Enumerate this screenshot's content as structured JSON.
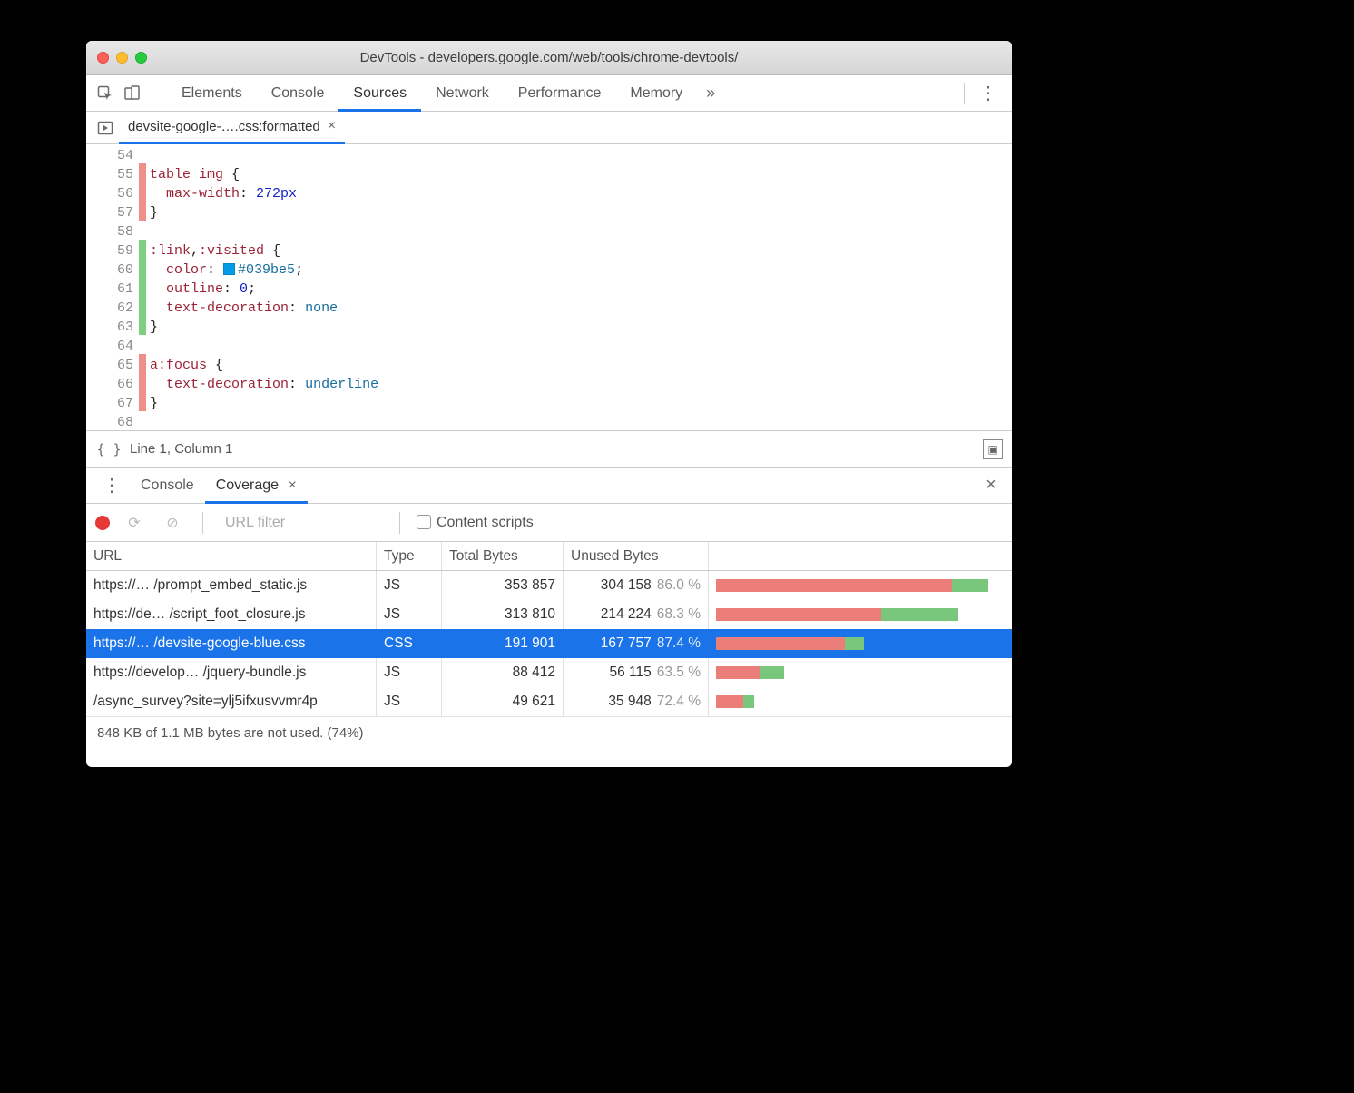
{
  "window": {
    "title": "DevTools - developers.google.com/web/tools/chrome-devtools/"
  },
  "tabs": {
    "items": [
      "Elements",
      "Console",
      "Sources",
      "Network",
      "Performance",
      "Memory"
    ],
    "active": "Sources",
    "overflow_glyph": "»"
  },
  "file_tab": {
    "label": "devsite-google-….css:formatted",
    "close_glyph": "×"
  },
  "code": {
    "lines": [
      {
        "num": "54",
        "cov": "",
        "html": ""
      },
      {
        "num": "55",
        "cov": "red",
        "html": "<span class=sel>table img</span> {"
      },
      {
        "num": "56",
        "cov": "red",
        "html": "  <span class=prop>max-width</span>: <span class=num>272px</span>"
      },
      {
        "num": "57",
        "cov": "red",
        "html": "}"
      },
      {
        "num": "58",
        "cov": "",
        "html": ""
      },
      {
        "num": "59",
        "cov": "green",
        "html": "<span class=sel>:link</span>,<span class=sel>:visited</span> {"
      },
      {
        "num": "60",
        "cov": "green",
        "html": "  <span class=prop>color</span>: <span class=swatch></span><span class=val>#039be5</span>;"
      },
      {
        "num": "61",
        "cov": "green",
        "html": "  <span class=prop>outline</span>: <span class=num>0</span>;"
      },
      {
        "num": "62",
        "cov": "green",
        "html": "  <span class=prop>text-decoration</span>: <span class=val>none</span>"
      },
      {
        "num": "63",
        "cov": "green",
        "html": "}"
      },
      {
        "num": "64",
        "cov": "",
        "html": ""
      },
      {
        "num": "65",
        "cov": "red",
        "html": "<span class=sel>a:focus</span> {"
      },
      {
        "num": "66",
        "cov": "red",
        "html": "  <span class=prop>text-decoration</span>: <span class=val>underline</span>"
      },
      {
        "num": "67",
        "cov": "red",
        "html": "}"
      },
      {
        "num": "68",
        "cov": "",
        "html": ""
      }
    ]
  },
  "status": {
    "format_glyph": "{ }",
    "cursor": "Line 1, Column 1"
  },
  "drawer": {
    "tabs": {
      "console": "Console",
      "coverage": "Coverage",
      "close_glyph": "×"
    },
    "toolbar": {
      "filter_placeholder": "URL filter",
      "content_scripts": "Content scripts"
    },
    "head": {
      "url": "URL",
      "type": "Type",
      "total": "Total Bytes",
      "unused": "Unused Bytes"
    },
    "rows": [
      {
        "url": "https://… /prompt_embed_static.js",
        "type": "JS",
        "total": "353 857",
        "unused": "304 158",
        "pct": "86.0 %",
        "bar_red": 260,
        "bar_green": 40,
        "selected": false
      },
      {
        "url": "https://de… /script_foot_closure.js",
        "type": "JS",
        "total": "313 810",
        "unused": "214 224",
        "pct": "68.3 %",
        "bar_red": 182,
        "bar_green": 85,
        "selected": false
      },
      {
        "url": "https://… /devsite-google-blue.css",
        "type": "CSS",
        "total": "191 901",
        "unused": "167 757",
        "pct": "87.4 %",
        "bar_red": 142,
        "bar_green": 21,
        "selected": true
      },
      {
        "url": "https://develop… /jquery-bundle.js",
        "type": "JS",
        "total": "88 412",
        "unused": "56 115",
        "pct": "63.5 %",
        "bar_red": 48,
        "bar_green": 27,
        "selected": false
      },
      {
        "url": "/async_survey?site=ylj5ifxusvvmr4p",
        "type": "JS",
        "total": "49 621",
        "unused": "35 948",
        "pct": "72.4 %",
        "bar_red": 30,
        "bar_green": 12,
        "selected": false
      }
    ],
    "summary": "848 KB of 1.1 MB bytes are not used. (74%)"
  }
}
